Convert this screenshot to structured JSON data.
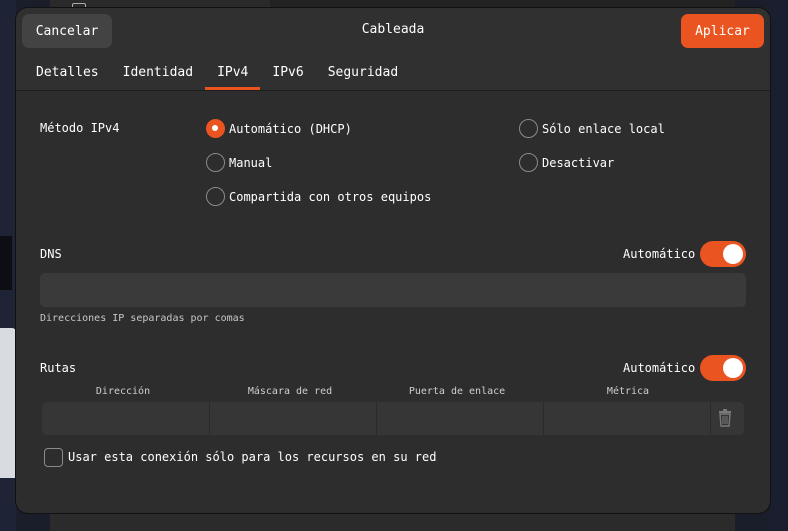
{
  "header": {
    "title": "Cableada",
    "cancel_label": "Cancelar",
    "apply_label": "Aplicar"
  },
  "tabs": [
    {
      "label": "Detalles",
      "active": false
    },
    {
      "label": "Identidad",
      "active": false
    },
    {
      "label": "IPv4",
      "active": true
    },
    {
      "label": "IPv6",
      "active": false
    },
    {
      "label": "Seguridad",
      "active": false
    }
  ],
  "ipv4_method": {
    "label": "Método IPv4",
    "options": [
      {
        "label": "Automático (DHCP)",
        "checked": true
      },
      {
        "label": "Manual",
        "checked": false
      },
      {
        "label": "Compartida con otros equipos",
        "checked": false
      },
      {
        "label": "Sólo enlace local",
        "checked": false
      },
      {
        "label": "Desactivar",
        "checked": false
      }
    ]
  },
  "dns": {
    "label": "DNS",
    "auto_label": "Automático",
    "auto_enabled": true,
    "value": "",
    "hint": "Direcciones IP separadas por comas"
  },
  "routes": {
    "label": "Rutas",
    "auto_label": "Automático",
    "auto_enabled": true,
    "columns": [
      "Dirección",
      "Máscara de red",
      "Puerta de enlace",
      "Métrica"
    ]
  },
  "local_only": {
    "label": "Usar esta conexión sólo para los recursos en su red",
    "checked": false
  },
  "colors": {
    "accent": "#e95420",
    "background": "#2d2d2d"
  }
}
